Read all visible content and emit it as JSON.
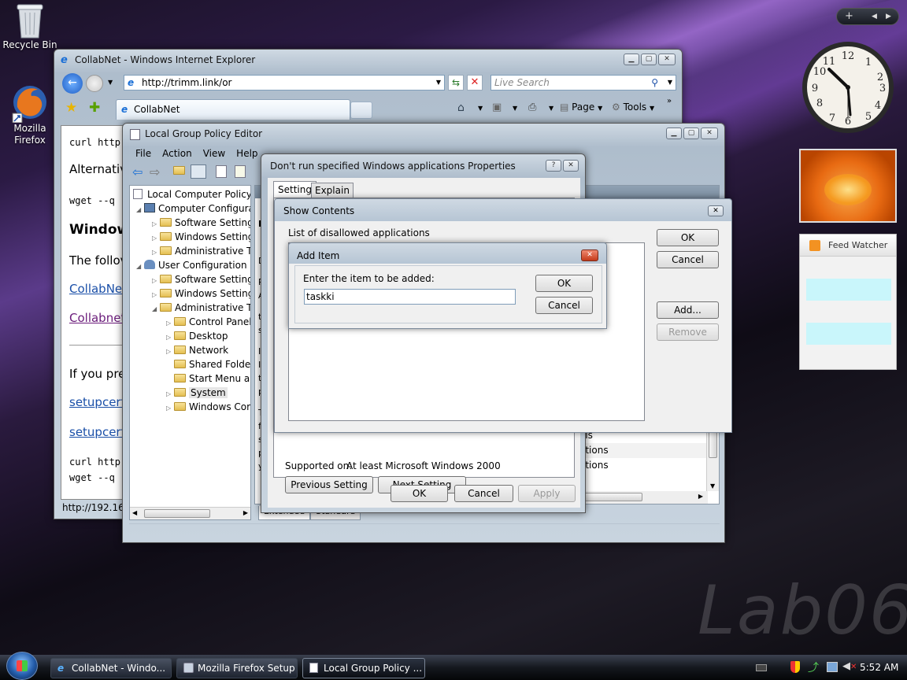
{
  "desktop": {
    "icons": [
      {
        "label": "Recycle Bin"
      },
      {
        "label": "Mozilla Firefox"
      }
    ],
    "watermark": "Lab06"
  },
  "sidebar_gadgets": {
    "feed_watcher_title": "Feed Watcher"
  },
  "ie": {
    "title": "CollabNet - Windows Internet Explorer",
    "url": "http://trimm.link/or",
    "search_placeholder": "Live Search",
    "tab": "CollabNet",
    "toolbar": {
      "page": "Page",
      "tools": "Tools"
    },
    "content": {
      "line1": "curl http",
      "line2": "Alternativ",
      "line3": "wget --q",
      "heading": "Window",
      "text1": "The follov",
      "link1": "CollabNet",
      "link2": "Collabnet",
      "text2": "If you pref",
      "link3": "setupcert.",
      "link4": "setupcert.",
      "line4": "curl http",
      "line5": "wget --q"
    },
    "status": "http://192.168."
  },
  "gpe": {
    "title": "Local Group Policy Editor",
    "menu": [
      "File",
      "Action",
      "View",
      "Help"
    ],
    "tree": [
      {
        "label": "Local Computer Policy",
        "indent": 0
      },
      {
        "label": "Computer Configura",
        "indent": 1
      },
      {
        "label": "Software Settings",
        "indent": 2
      },
      {
        "label": "Windows Setting",
        "indent": 2
      },
      {
        "label": "Administrative Te",
        "indent": 2
      },
      {
        "label": "User Configuration",
        "indent": 1
      },
      {
        "label": "Software Settings",
        "indent": 2
      },
      {
        "label": "Windows Setting",
        "indent": 2
      },
      {
        "label": "Administrative Te",
        "indent": 2
      },
      {
        "label": "Control Panel",
        "indent": 3
      },
      {
        "label": "Desktop",
        "indent": 3
      },
      {
        "label": "Network",
        "indent": 3
      },
      {
        "label": "Shared Folder",
        "indent": 3
      },
      {
        "label": "Start Menu ar",
        "indent": 3
      },
      {
        "label": "System",
        "indent": 3
      },
      {
        "label": "Windows Cor",
        "indent": 3
      }
    ],
    "right_list": [
      "ols",
      "ations",
      "ations"
    ],
    "tabs": [
      "Extended",
      "Standard"
    ],
    "stub_letters": [
      "D",
      "D",
      "R",
      "A",
      "t",
      "s",
      "I",
      "I",
      "t",
      "p",
      "T",
      "f",
      "s",
      "p",
      "y"
    ]
  },
  "props": {
    "title": "Don't run specified Windows applications Properties",
    "tabs": [
      "Setting",
      "Explain"
    ],
    "supported_label": "Supported on:",
    "supported_value": "At least Microsoft Windows 2000",
    "prev_button": "Previous Setting",
    "next_button": "Next Setting",
    "ok": "OK",
    "cancel": "Cancel",
    "apply": "Apply"
  },
  "show_contents": {
    "title": "Show Contents",
    "list_label": "List of disallowed applications",
    "ok": "OK",
    "cancel": "Cancel",
    "add": "Add...",
    "remove": "Remove"
  },
  "add_item": {
    "title": "Add Item",
    "prompt": "Enter the item to be added:",
    "value": "taskki",
    "ok": "OK",
    "cancel": "Cancel"
  },
  "taskbar": {
    "items": [
      {
        "label": "CollabNet - Windo..."
      },
      {
        "label": "Mozilla Firefox Setup"
      },
      {
        "label": "Local Group Policy ..."
      }
    ],
    "clock": "5:52 AM"
  },
  "colors": {
    "accent": "#1a4fa8",
    "visited": "#6a1b7a",
    "list_highlight": "#c9f6fb"
  }
}
